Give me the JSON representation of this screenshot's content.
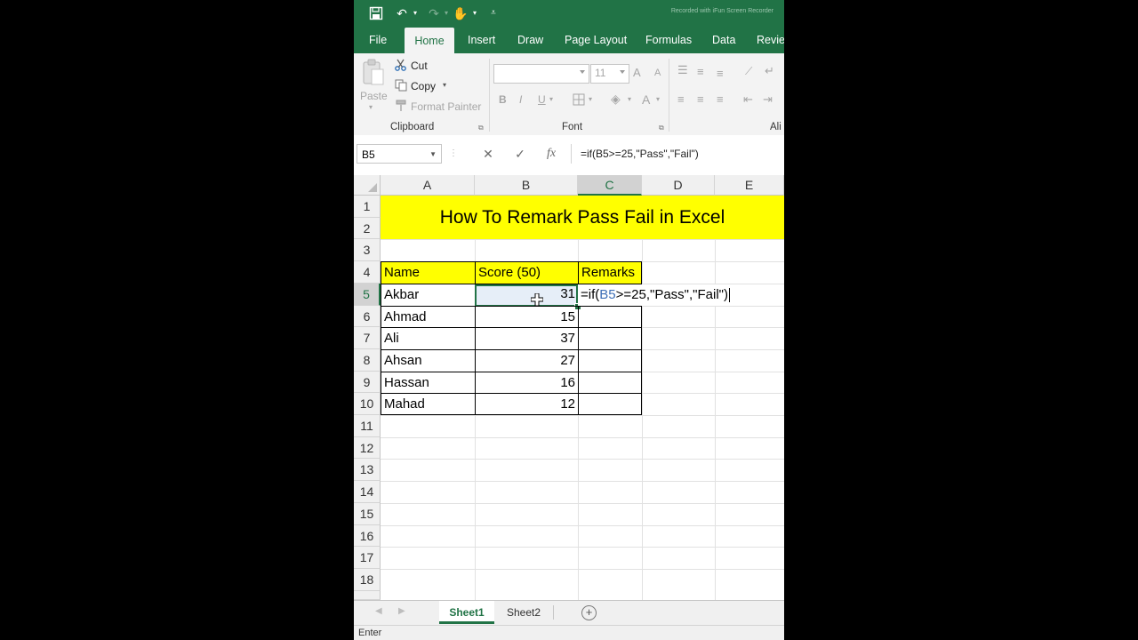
{
  "window": {
    "watermark": "Recorded with iFun Screen Recorder"
  },
  "tabs": [
    "File",
    "Home",
    "Insert",
    "Draw",
    "Page Layout",
    "Formulas",
    "Data",
    "Review"
  ],
  "active_tab": "Home",
  "ribbon": {
    "clipboard": {
      "paste": "Paste",
      "cut": "Cut",
      "copy": "Copy",
      "format_painter": "Format Painter",
      "label": "Clipboard"
    },
    "font": {
      "font_name": "",
      "font_size": "11",
      "label": "Font",
      "bold": "B",
      "italic": "I",
      "underline": "U",
      "grow": "A",
      "shrink": "A",
      "color": "A"
    },
    "alignment": {
      "label": "Ali"
    }
  },
  "formula_bar": {
    "name_box": "B5",
    "cancel_icon": "✕",
    "enter_icon": "✓",
    "fx": "fx",
    "formula": "=if(B5>=25,\"Pass\",\"Fail\")"
  },
  "grid": {
    "columns": [
      "A",
      "B",
      "C",
      "D",
      "E"
    ],
    "rows": [
      "1",
      "2",
      "3",
      "4",
      "5",
      "6",
      "7",
      "8",
      "9",
      "10",
      "11",
      "12",
      "13",
      "14",
      "15",
      "16",
      "17",
      "18"
    ],
    "title": "How To Remark Pass Fail in Excel",
    "headers": {
      "name": "Name",
      "score": "Score (50)",
      "remarks": "Remarks"
    },
    "records": [
      {
        "name": "Akbar",
        "score": "31"
      },
      {
        "name": "Ahmad",
        "score": "15"
      },
      {
        "name": "Ali",
        "score": "37"
      },
      {
        "name": "Ahsan",
        "score": "27"
      },
      {
        "name": "Hassan",
        "score": "16"
      },
      {
        "name": "Mahad",
        "score": "12"
      }
    ],
    "editing": {
      "prefix": "=if(",
      "ref": "B5",
      "suffix": ">=25,\"Pass\",\"Fail\")"
    }
  },
  "sheets": [
    "Sheet1",
    "Sheet2"
  ],
  "active_sheet": "Sheet1",
  "status": "Enter",
  "colors": {
    "excel_green": "#217346",
    "highlight": "#ffff00",
    "ref_blue": "#3d6fb6"
  }
}
